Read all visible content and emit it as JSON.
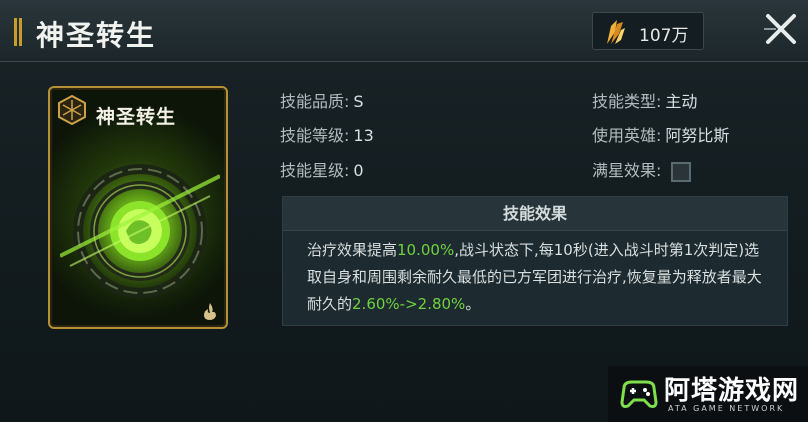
{
  "header": {
    "title": "神圣转生",
    "currency_amount": "107万",
    "currency_icon": "gold-crystal-icon",
    "close_icon": "close-icon"
  },
  "card": {
    "title": "神圣转生",
    "badge_icon": "hexagon-emblem-icon",
    "corner_icon": "flame-icon",
    "accent": "#b59034",
    "glow": "#8be32a"
  },
  "skill": {
    "quality_label": "技能品质:",
    "quality_value": "S",
    "level_label": "技能等级:",
    "level_value": "13",
    "star_label": "技能星级:",
    "star_value": "0",
    "type_label": "技能类型:",
    "type_value": "主动",
    "hero_label": "使用英雄:",
    "hero_value": "阿努比斯",
    "fullstar_label": "满星效果:",
    "fullstar_checked": false
  },
  "effect": {
    "heading": "技能效果",
    "t1": "治疗效果提高",
    "v1": "10.00%",
    "t2": ",战斗状态下,每10秒(进入战斗时第1次判定)选取自身和周围剩余耐久最低的已方军团进行治疗,恢复量为释放者最大耐久的",
    "v2": "2.60%->2.80%",
    "t3": "。"
  },
  "watermark": {
    "logo_cn": "阿塔游戏网",
    "logo_en": "ATA GAME NETWORK",
    "logo_icon": "gamepad-icon"
  }
}
